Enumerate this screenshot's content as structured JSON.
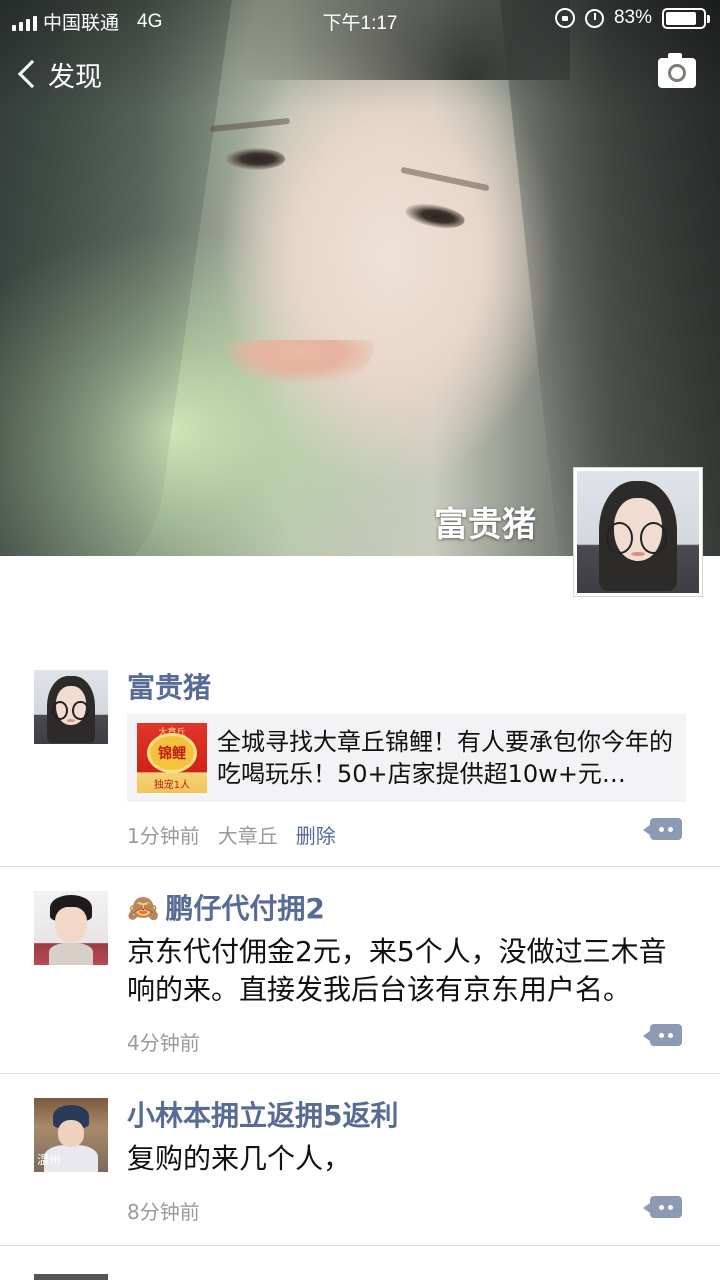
{
  "status_bar": {
    "carrier": "中国联通",
    "network": "4G",
    "time": "下午1:17",
    "battery": "83%",
    "battery_level": 0.83
  },
  "nav": {
    "back_label": "发现",
    "back_icon": "chevron-left-icon",
    "camera_icon": "camera-icon"
  },
  "profile": {
    "name": "富贵猪"
  },
  "posts": [
    {
      "author": "富贵猪",
      "link": {
        "title": "全城寻找大章丘锦鲤！有人要承包你今年的吃喝玩乐！50+店家提供超10w+元…",
        "thumb_top": "大章丘",
        "thumb_main": "锦鲤",
        "thumb_bottom": "独宠1人"
      },
      "time": "1分钟前",
      "location": "大章丘",
      "delete_label": "删除"
    },
    {
      "author_emoji": "🙈",
      "author": "鹏仔代付拥2",
      "text": "京东代付佣金2元，来5个人，没做过三木音响的来。直接发我后台该有京东用户名。",
      "time": "4分钟前"
    },
    {
      "author": "小林本拥立返拥5返利",
      "text": "复购的来几个人，",
      "time": "8分钟前",
      "avatar_tag": "温州"
    }
  ]
}
